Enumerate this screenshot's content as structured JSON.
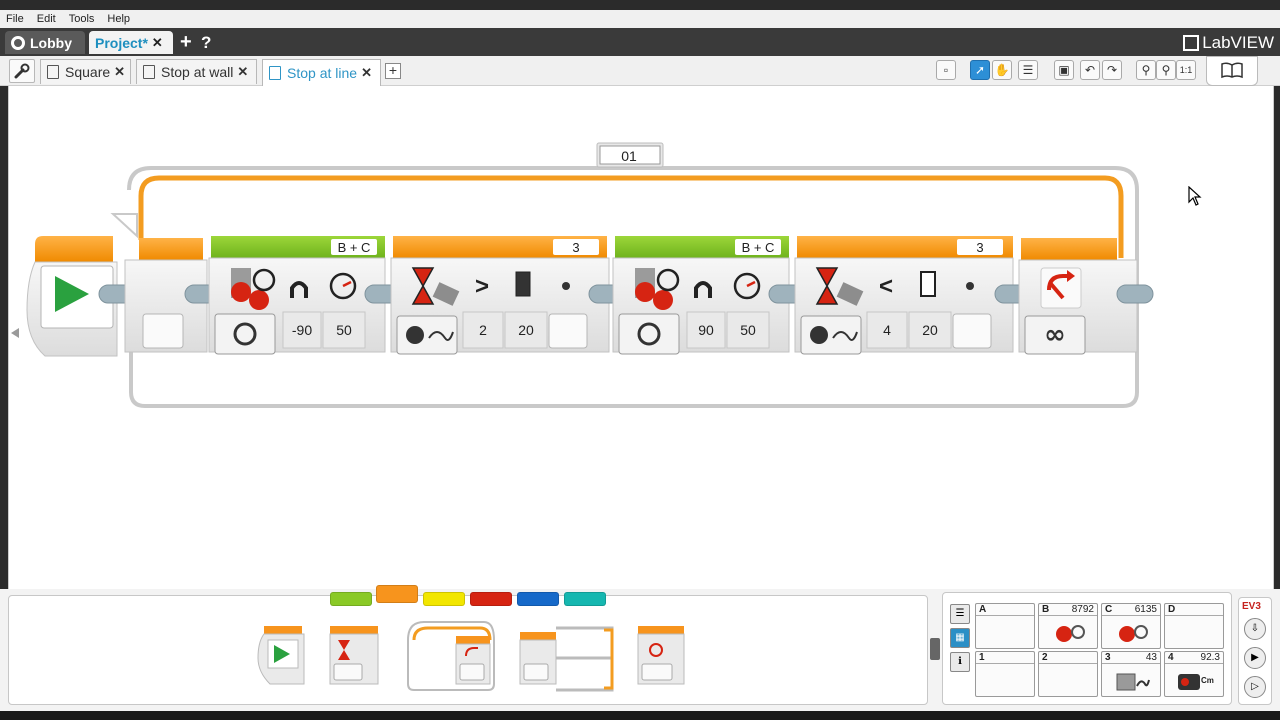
{
  "menu": [
    "File",
    "Edit",
    "Tools",
    "Help"
  ],
  "projects": {
    "lobby": "Lobby",
    "project": "Project*",
    "close": "✕",
    "add": "+",
    "help": "?",
    "brand": "LabVIEW"
  },
  "program_tabs": [
    {
      "label": "Square",
      "active": false
    },
    {
      "label": "Stop at wall",
      "active": false
    },
    {
      "label": "Stop at line",
      "active": true
    }
  ],
  "tab_close": "✕",
  "toolbar": {
    "zoom_reset": "1:1",
    "icons": [
      "new-comment-icon",
      "select-pointer-icon",
      "pan-hand-icon",
      "comment-icon",
      "save-icon",
      "undo-icon",
      "redo-icon",
      "zoom-out-icon",
      "zoom-in-icon",
      "zoom-reset-icon",
      "content-editor-icon"
    ]
  },
  "loop": {
    "name": "01",
    "exit_mode": "∞"
  },
  "blocks": [
    {
      "type": "start",
      "color": "#f7941d"
    },
    {
      "type": "move-steering",
      "ports": "B + C",
      "mode": "on",
      "steering": "-90",
      "power": "50",
      "steer_icon": "u-turn-left"
    },
    {
      "type": "wait-color-light",
      "port": "3",
      "compare": ">",
      "threshold": "2",
      "value": "20",
      "light_icon": "dark-square"
    },
    {
      "type": "move-steering",
      "ports": "B + C",
      "mode": "on",
      "steering": "90",
      "power": "50",
      "steer_icon": "u-turn-right"
    },
    {
      "type": "wait-color-light",
      "port": "3",
      "compare": "<",
      "threshold": "4",
      "value": "20",
      "light_icon": "light-square"
    }
  ],
  "palette_tabs": [
    {
      "color": "#8ac926",
      "selected": false
    },
    {
      "color": "#f7941d",
      "selected": true
    },
    {
      "color": "#f2e600",
      "selected": false
    },
    {
      "color": "#d62412",
      "selected": false
    },
    {
      "color": "#1669c9",
      "selected": false
    },
    {
      "color": "#16b7b0",
      "selected": false
    }
  ],
  "palette_blocks": [
    "start-block-icon",
    "wait-block-icon",
    "loop-block-icon",
    "switch-block-icon",
    "loop-interrupt-block-icon"
  ],
  "hardware": {
    "ports_top": [
      {
        "name": "A",
        "value": ""
      },
      {
        "name": "B",
        "value": "8792"
      },
      {
        "name": "C",
        "value": "6135"
      },
      {
        "name": "D",
        "value": ""
      }
    ],
    "ports_bottom": [
      {
        "name": "1",
        "value": ""
      },
      {
        "name": "2",
        "value": ""
      },
      {
        "name": "3",
        "value": "43"
      },
      {
        "name": "4",
        "value": "92.3"
      }
    ],
    "ultrasonic_unit": "Cm",
    "brick": "EV3"
  }
}
